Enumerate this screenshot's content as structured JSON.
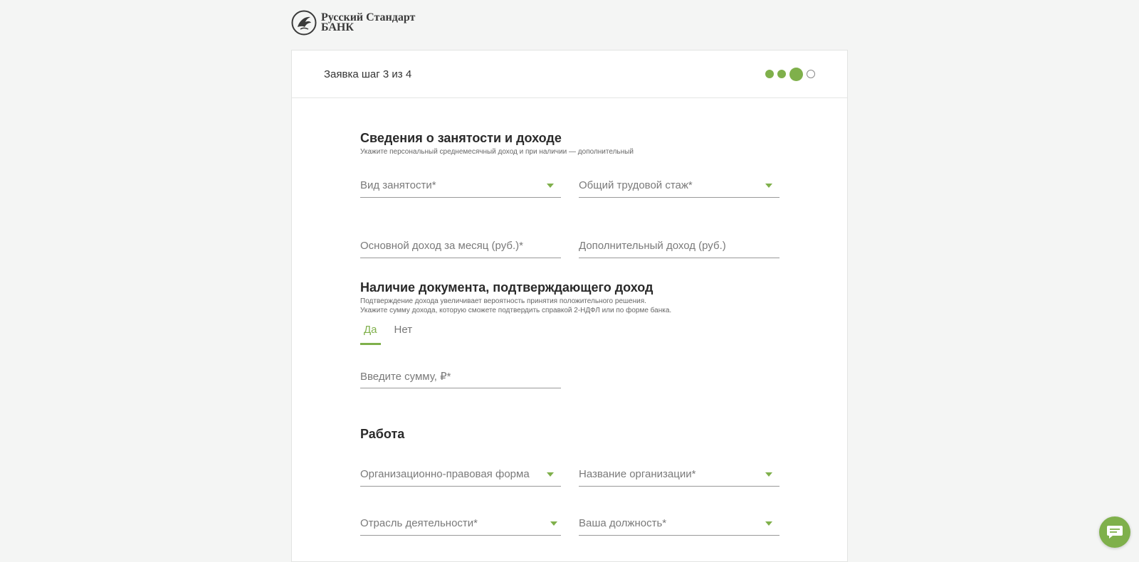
{
  "brand": {
    "line1": "Русский Стандарт",
    "line2": "Банк"
  },
  "header": {
    "step_title": "Заявка шаг 3 из 4"
  },
  "employment": {
    "title": "Сведения о занятости и доходе",
    "subtitle": "Укажите персональный среднемесячный доход и при наличии — дополнительный",
    "employment_type": "Вид занятости*",
    "total_experience": "Общий трудовой стаж*",
    "main_income": "Основной доход за месяц (руб.)*",
    "additional_income": "Дополнительный доход (руб.)"
  },
  "document": {
    "title": "Наличие документа, подтверждающего доход",
    "subtitle1": "Подтверждение дохода увеличивает вероятность принятия положительного решения.",
    "subtitle2": "Укажите сумму дохода, которую сможете подтвердить справкой 2-НДФЛ или по форме банка.",
    "tab_yes": "Да",
    "tab_no": "Нет",
    "amount_placeholder": "Введите сумму, ₽*"
  },
  "work": {
    "title": "Работа",
    "legal_form": "Организационно-правовая форма",
    "org_name": "Название организации*",
    "industry": "Отрасль деятельности*",
    "position": "Ваша должность*"
  },
  "colors": {
    "accent": "#7fb04b",
    "background": "#f4f5f4"
  },
  "icons": {
    "chat": "chat-icon",
    "logo": "griffin-logo-icon"
  }
}
